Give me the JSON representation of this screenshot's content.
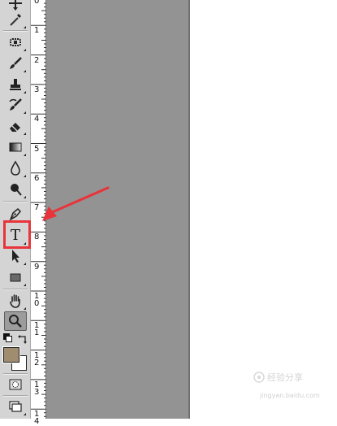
{
  "toolbar": {
    "tools": [
      {
        "name": "move-tool",
        "icon": "move-icon"
      },
      {
        "name": "eyedropper-tool",
        "icon": "eyedropper-icon"
      },
      {
        "name": "spot-healing-tool",
        "icon": "bandage-icon"
      },
      {
        "name": "brush-tool",
        "icon": "brush-icon"
      },
      {
        "name": "clone-stamp-tool",
        "icon": "stamp-icon"
      },
      {
        "name": "history-brush-tool",
        "icon": "history-brush-icon"
      },
      {
        "name": "eraser-tool",
        "icon": "eraser-icon"
      },
      {
        "name": "gradient-tool",
        "icon": "gradient-icon"
      },
      {
        "name": "blur-tool",
        "icon": "drop-icon"
      },
      {
        "name": "dodge-tool",
        "icon": "dodge-icon"
      },
      {
        "name": "pen-tool",
        "icon": "pen-icon"
      },
      {
        "name": "type-tool",
        "icon": "type-icon",
        "label": "T"
      },
      {
        "name": "path-selection-tool",
        "icon": "arrow-cursor-icon"
      },
      {
        "name": "rectangle-tool",
        "icon": "rectangle-icon"
      },
      {
        "name": "hand-tool",
        "icon": "hand-icon"
      },
      {
        "name": "zoom-tool",
        "icon": "magnifier-icon",
        "active": true
      },
      {
        "name": "quick-mask",
        "icon": "quick-mask-icon"
      },
      {
        "name": "screen-mode",
        "icon": "screen-mode-icon"
      }
    ],
    "foreground_color": "#a08c6e",
    "background_color": "#ffffff"
  },
  "ruler": {
    "labels": [
      "0",
      "1",
      "2",
      "3",
      "4",
      "5",
      "6",
      "7",
      "8",
      "9",
      "1\n0",
      "1\n1",
      "1\n2",
      "1\n3",
      "1\n4"
    ]
  },
  "annotation": {
    "highlight_color": "#e8343b",
    "arrow_color": "#e8343b"
  },
  "watermark": {
    "label": "经验分享",
    "url": "jingyan.baidu.com"
  }
}
